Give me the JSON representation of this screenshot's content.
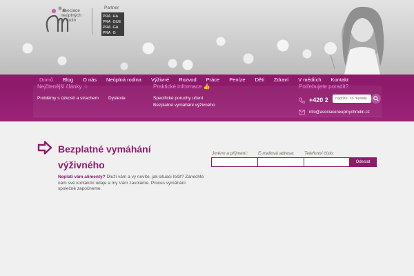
{
  "header": {
    "logo_lines": [
      "asociace",
      "neúplných",
      "rodin"
    ],
    "partner_label": "Partner",
    "partner_logo_cells": [
      "PRA",
      "HA",
      "PRA",
      "GUE",
      "PRA",
      "GA",
      "PRA",
      "G"
    ]
  },
  "nav": {
    "items": [
      {
        "label": "Domů",
        "active": true
      },
      {
        "label": "Blog"
      },
      {
        "label": "O nás"
      },
      {
        "label": "Neúplná rodina"
      },
      {
        "label": "Výživné"
      },
      {
        "label": "Rozvod"
      },
      {
        "label": "Práce"
      },
      {
        "label": "Peníze"
      },
      {
        "label": "Děti"
      },
      {
        "label": "Zdraví"
      },
      {
        "label": "V médiích"
      },
      {
        "label": "Kontakt"
      }
    ]
  },
  "band": {
    "most_read_title": "Nejčtenější články",
    "most_read_links": [
      "Problémy s úzkostí a strachem",
      "Dyslexie"
    ],
    "practical_title": "Praktické informace",
    "practical_links": [
      "Specifické poruchy učení",
      "Bezplatné vymáhání výživného"
    ],
    "help_title": "Potřebujete poradit?",
    "phone": "+420 2",
    "search_placeholder": "napište, co hledáte",
    "email": "info@asociaceneuplnychrodin.cz"
  },
  "main": {
    "title": "Bezplatné vymáhání výživného",
    "lead_bold": "Neplatí vám alimenty?",
    "lead_rest": " Dluží vám a vy nevíte, jak situaci řešit? Zanechte nám své kontaktní údaje a my Vám zavoláme. Proces vymáhání společně započneme."
  },
  "form": {
    "name_label": "Jméno a příjmení:",
    "email_label": "E-mailová adresa:",
    "phone_label": "Telefonní číslo:",
    "submit_label": "Odeslat"
  },
  "colors": {
    "brand_purple": "#8e1a6b",
    "accent_pink": "#ee8ddc",
    "page_bg": "#f1f0f0"
  }
}
